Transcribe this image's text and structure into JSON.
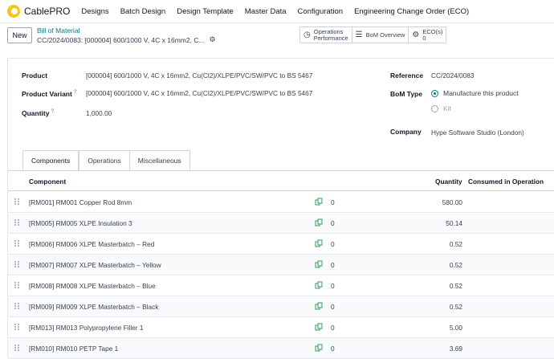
{
  "app": {
    "name": "CablePRO",
    "menu": [
      "Designs",
      "Batch Design",
      "Design Template",
      "Master Data",
      "Configuration",
      "Engineering Change Order (ECO)"
    ]
  },
  "control": {
    "new_label": "New",
    "breadcrumb_parent": "Bill of Material",
    "breadcrumb_current": "CC/2024/0083: [000004] 600/1000 V, 4C x 16mm2, C...",
    "smart": {
      "ops_line1": "Operations",
      "ops_line2": "Performance",
      "bom_overview": "BoM Overview",
      "eco_label": "ECO(s)",
      "eco_count": "0"
    }
  },
  "form": {
    "product_label": "Product",
    "product_value": "[000004] 600/1000 V, 4C x 16mm2, Cu(Cl2)/XLPE/PVC/SW/PVC to BS 5467",
    "variant_label": "Product Variant",
    "variant_value": "[000004] 600/1000 V, 4C x 16mm2, Cu(Cl2)/XLPE/PVC/SW/PVC to BS 5467",
    "quantity_label": "Quantity",
    "quantity_value": "1,000.00",
    "tooltip_mark": "?",
    "reference_label": "Reference",
    "reference_value": "CC/2024/0083",
    "bomtype_label": "BoM Type",
    "bomtype_option1": "Manufacture this product",
    "bomtype_option2": "Kit",
    "company_label": "Company",
    "company_value": "Hype Software Studio (London)"
  },
  "tabs": [
    "Components",
    "Operations",
    "Miscellaneous"
  ],
  "table": {
    "headers": {
      "component": "Component",
      "quantity": "Quantity",
      "consumed": "Consumed in Operation"
    },
    "rows": [
      {
        "component": "[RM001] RM001 Copper Rod 8mm",
        "zero": "0",
        "quantity": "580.00"
      },
      {
        "component": "[RM005] RM005 XLPE Insulation 3",
        "zero": "0",
        "quantity": "50.14"
      },
      {
        "component": "[RM006] RM006 XLPE Masterbatch – Red",
        "zero": "0",
        "quantity": "0.52"
      },
      {
        "component": "[RM007] RM007 XLPE Masterbatch – Yellow",
        "zero": "0",
        "quantity": "0.52"
      },
      {
        "component": "[RM008] RM008 XLPE Masterbatch – Blue",
        "zero": "0",
        "quantity": "0.52"
      },
      {
        "component": "[RM009] RM009 XLPE Masterbatch – Black",
        "zero": "0",
        "quantity": "0.52"
      },
      {
        "component": "[RM013] RM013 Polypropylene Filler 1",
        "zero": "0",
        "quantity": "5.00"
      },
      {
        "component": "[RM010] RM010 PETP Tape 1",
        "zero": "0",
        "quantity": "3.69"
      }
    ]
  },
  "colors": {
    "accent": "#017e84",
    "logo": "#f5c518",
    "link_icon": "#2e9c5a"
  },
  "icons": [
    "app-logo-icon",
    "gear-icon",
    "clock-icon",
    "list-icon",
    "cogs-icon",
    "drag-handle-icon",
    "copy-link-icon"
  ]
}
